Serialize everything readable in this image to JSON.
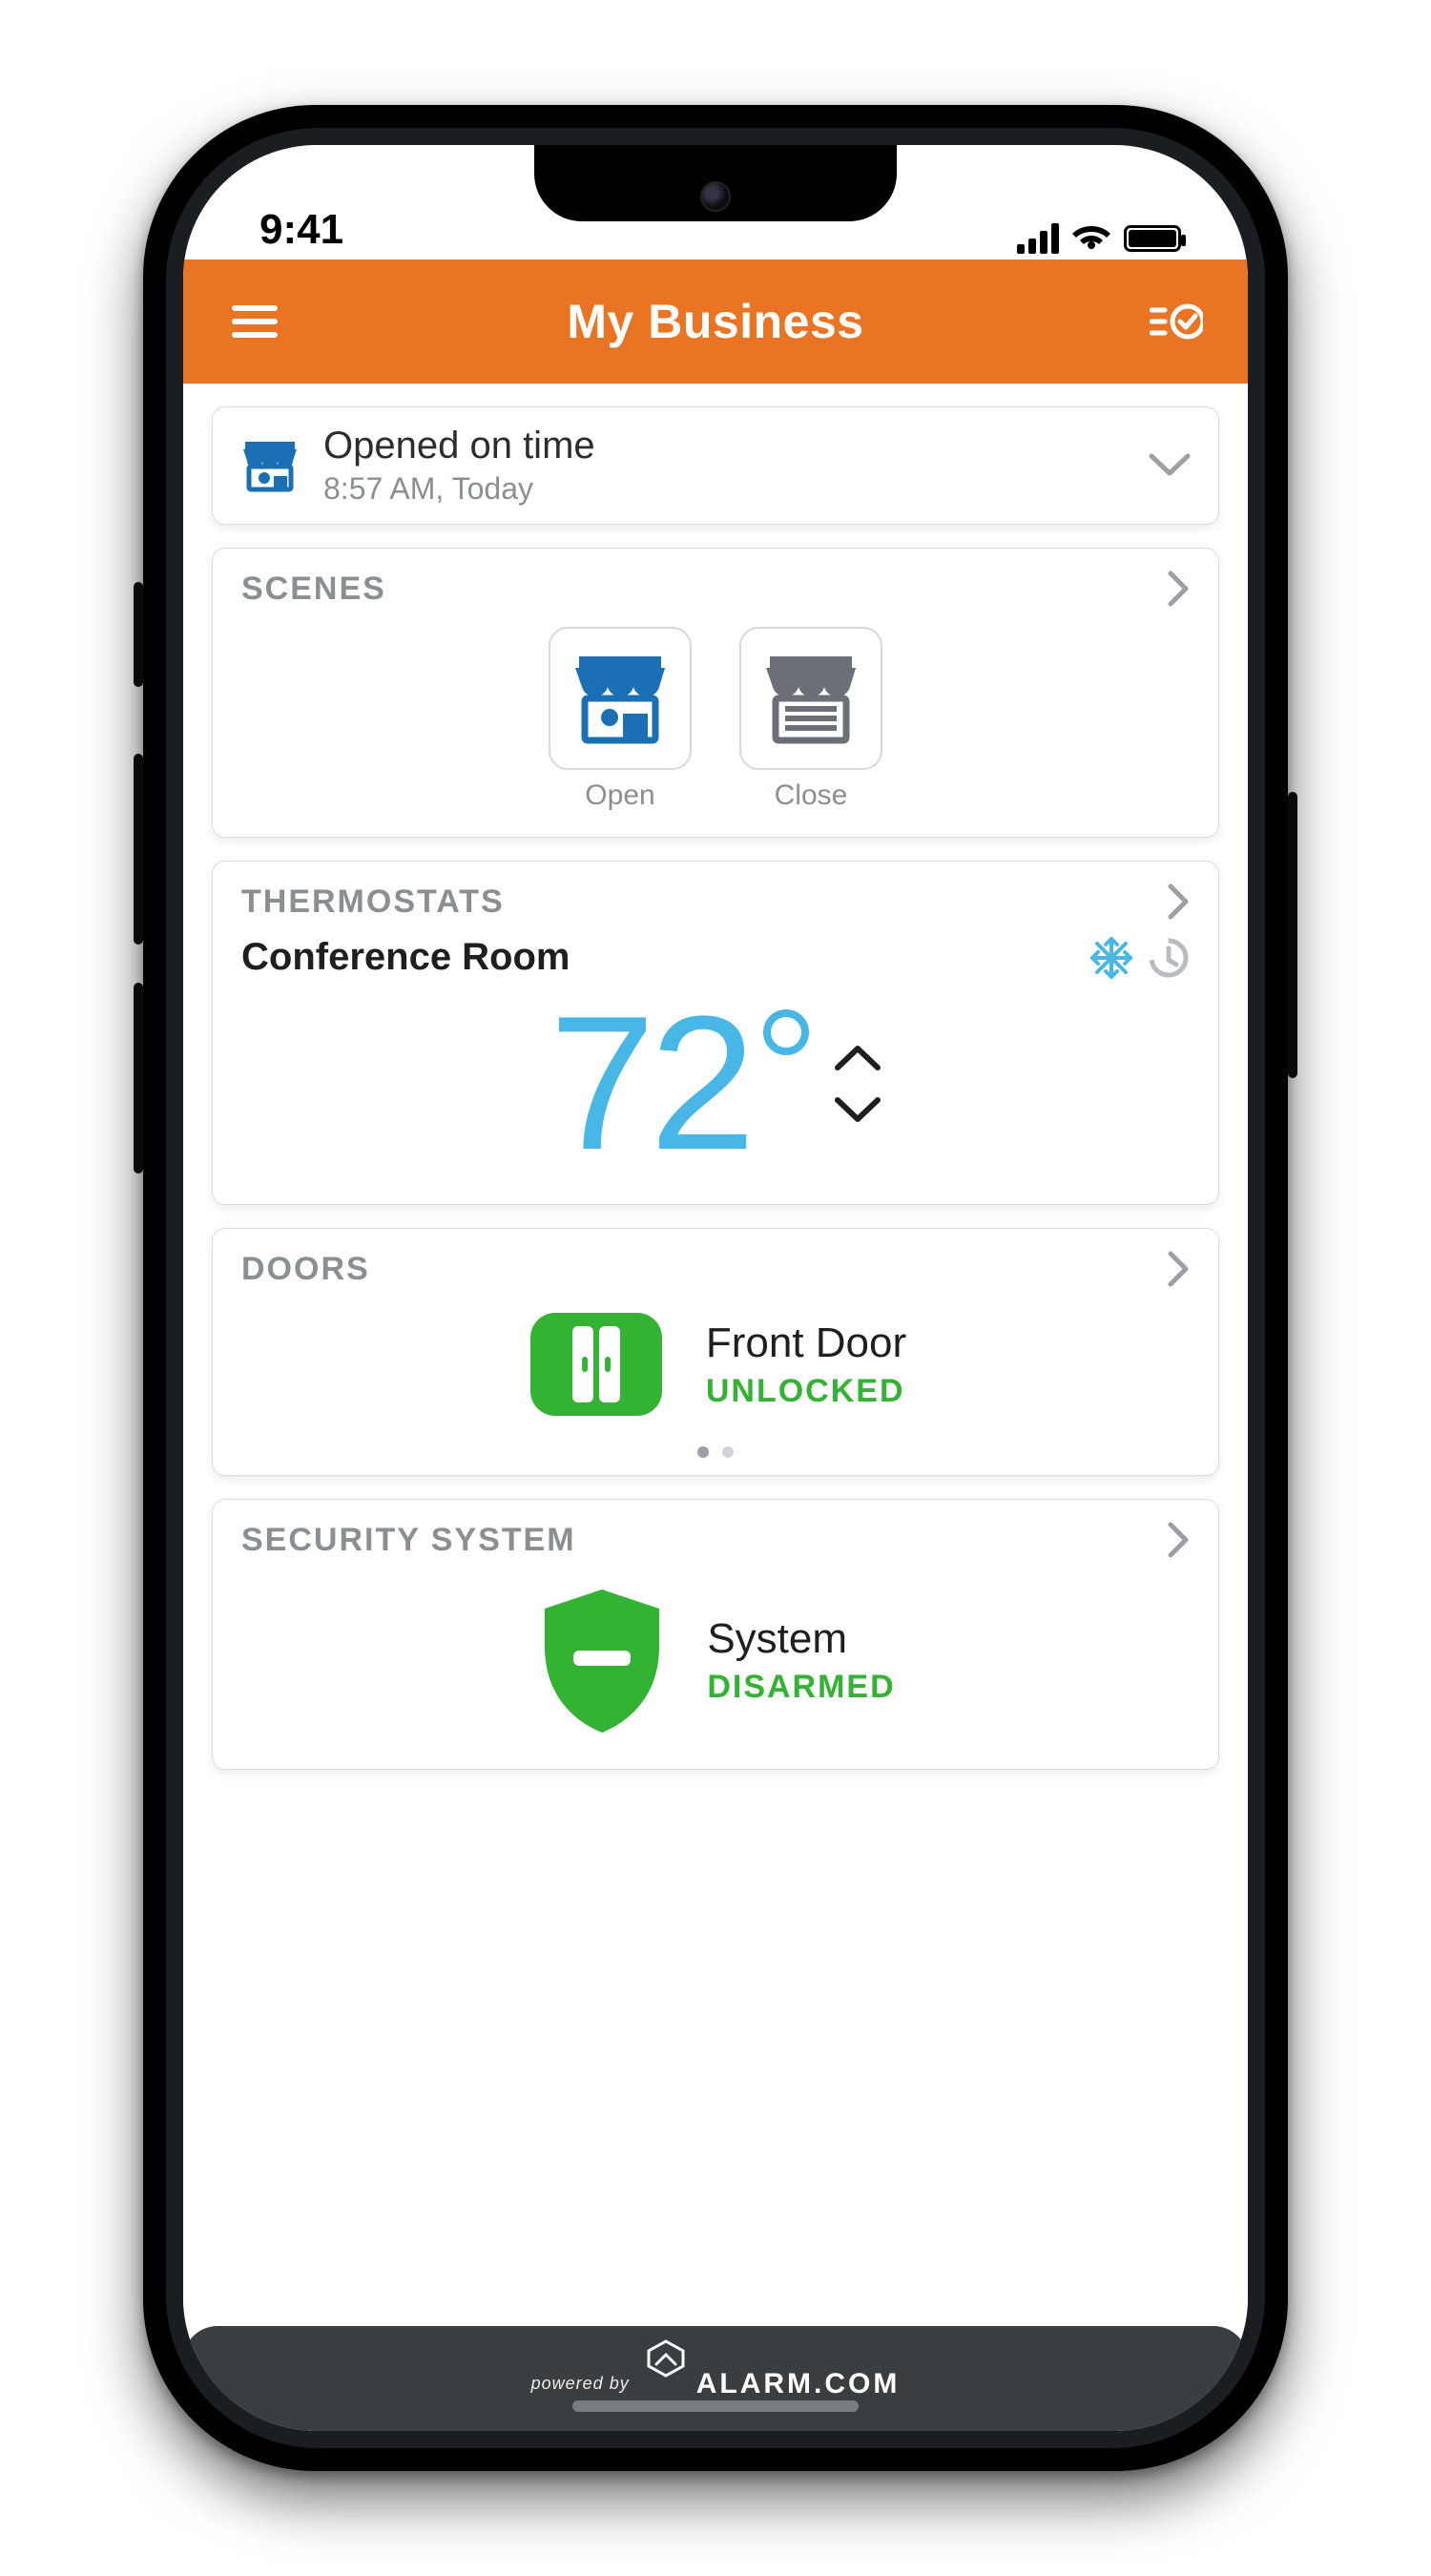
{
  "statusbar": {
    "time": "9:41"
  },
  "header": {
    "title": "My Business",
    "menu_icon": "menu-icon",
    "right_icon": "scene-check-icon"
  },
  "status_card": {
    "icon": "storefront-open-icon",
    "title": "Opened on time",
    "subtitle": "8:57 AM, Today"
  },
  "scenes": {
    "header": "SCENES",
    "items": [
      {
        "label": "Open",
        "icon": "storefront-open-icon"
      },
      {
        "label": "Close",
        "icon": "storefront-closed-icon"
      }
    ]
  },
  "thermostats": {
    "header": "THERMOSTATS",
    "room": "Conference Room",
    "temperature": "72",
    "mode_icon": "snowflake-icon",
    "schedule_icon": "schedule-icon",
    "temperature_color": "#49b7e6"
  },
  "doors": {
    "header": "DOORS",
    "name": "Front Door",
    "state": "UNLOCKED",
    "state_color": "#34b233"
  },
  "security": {
    "header": "SECURITY SYSTEM",
    "name": "System",
    "state": "DISARMED",
    "state_color": "#34b233"
  },
  "footer": {
    "powered_by": "powered by",
    "brand": "ALARM.COM"
  },
  "colors": {
    "accent_orange": "#e87424",
    "accent_blue": "#1b6fb5",
    "text_muted": "#8a8f94"
  }
}
